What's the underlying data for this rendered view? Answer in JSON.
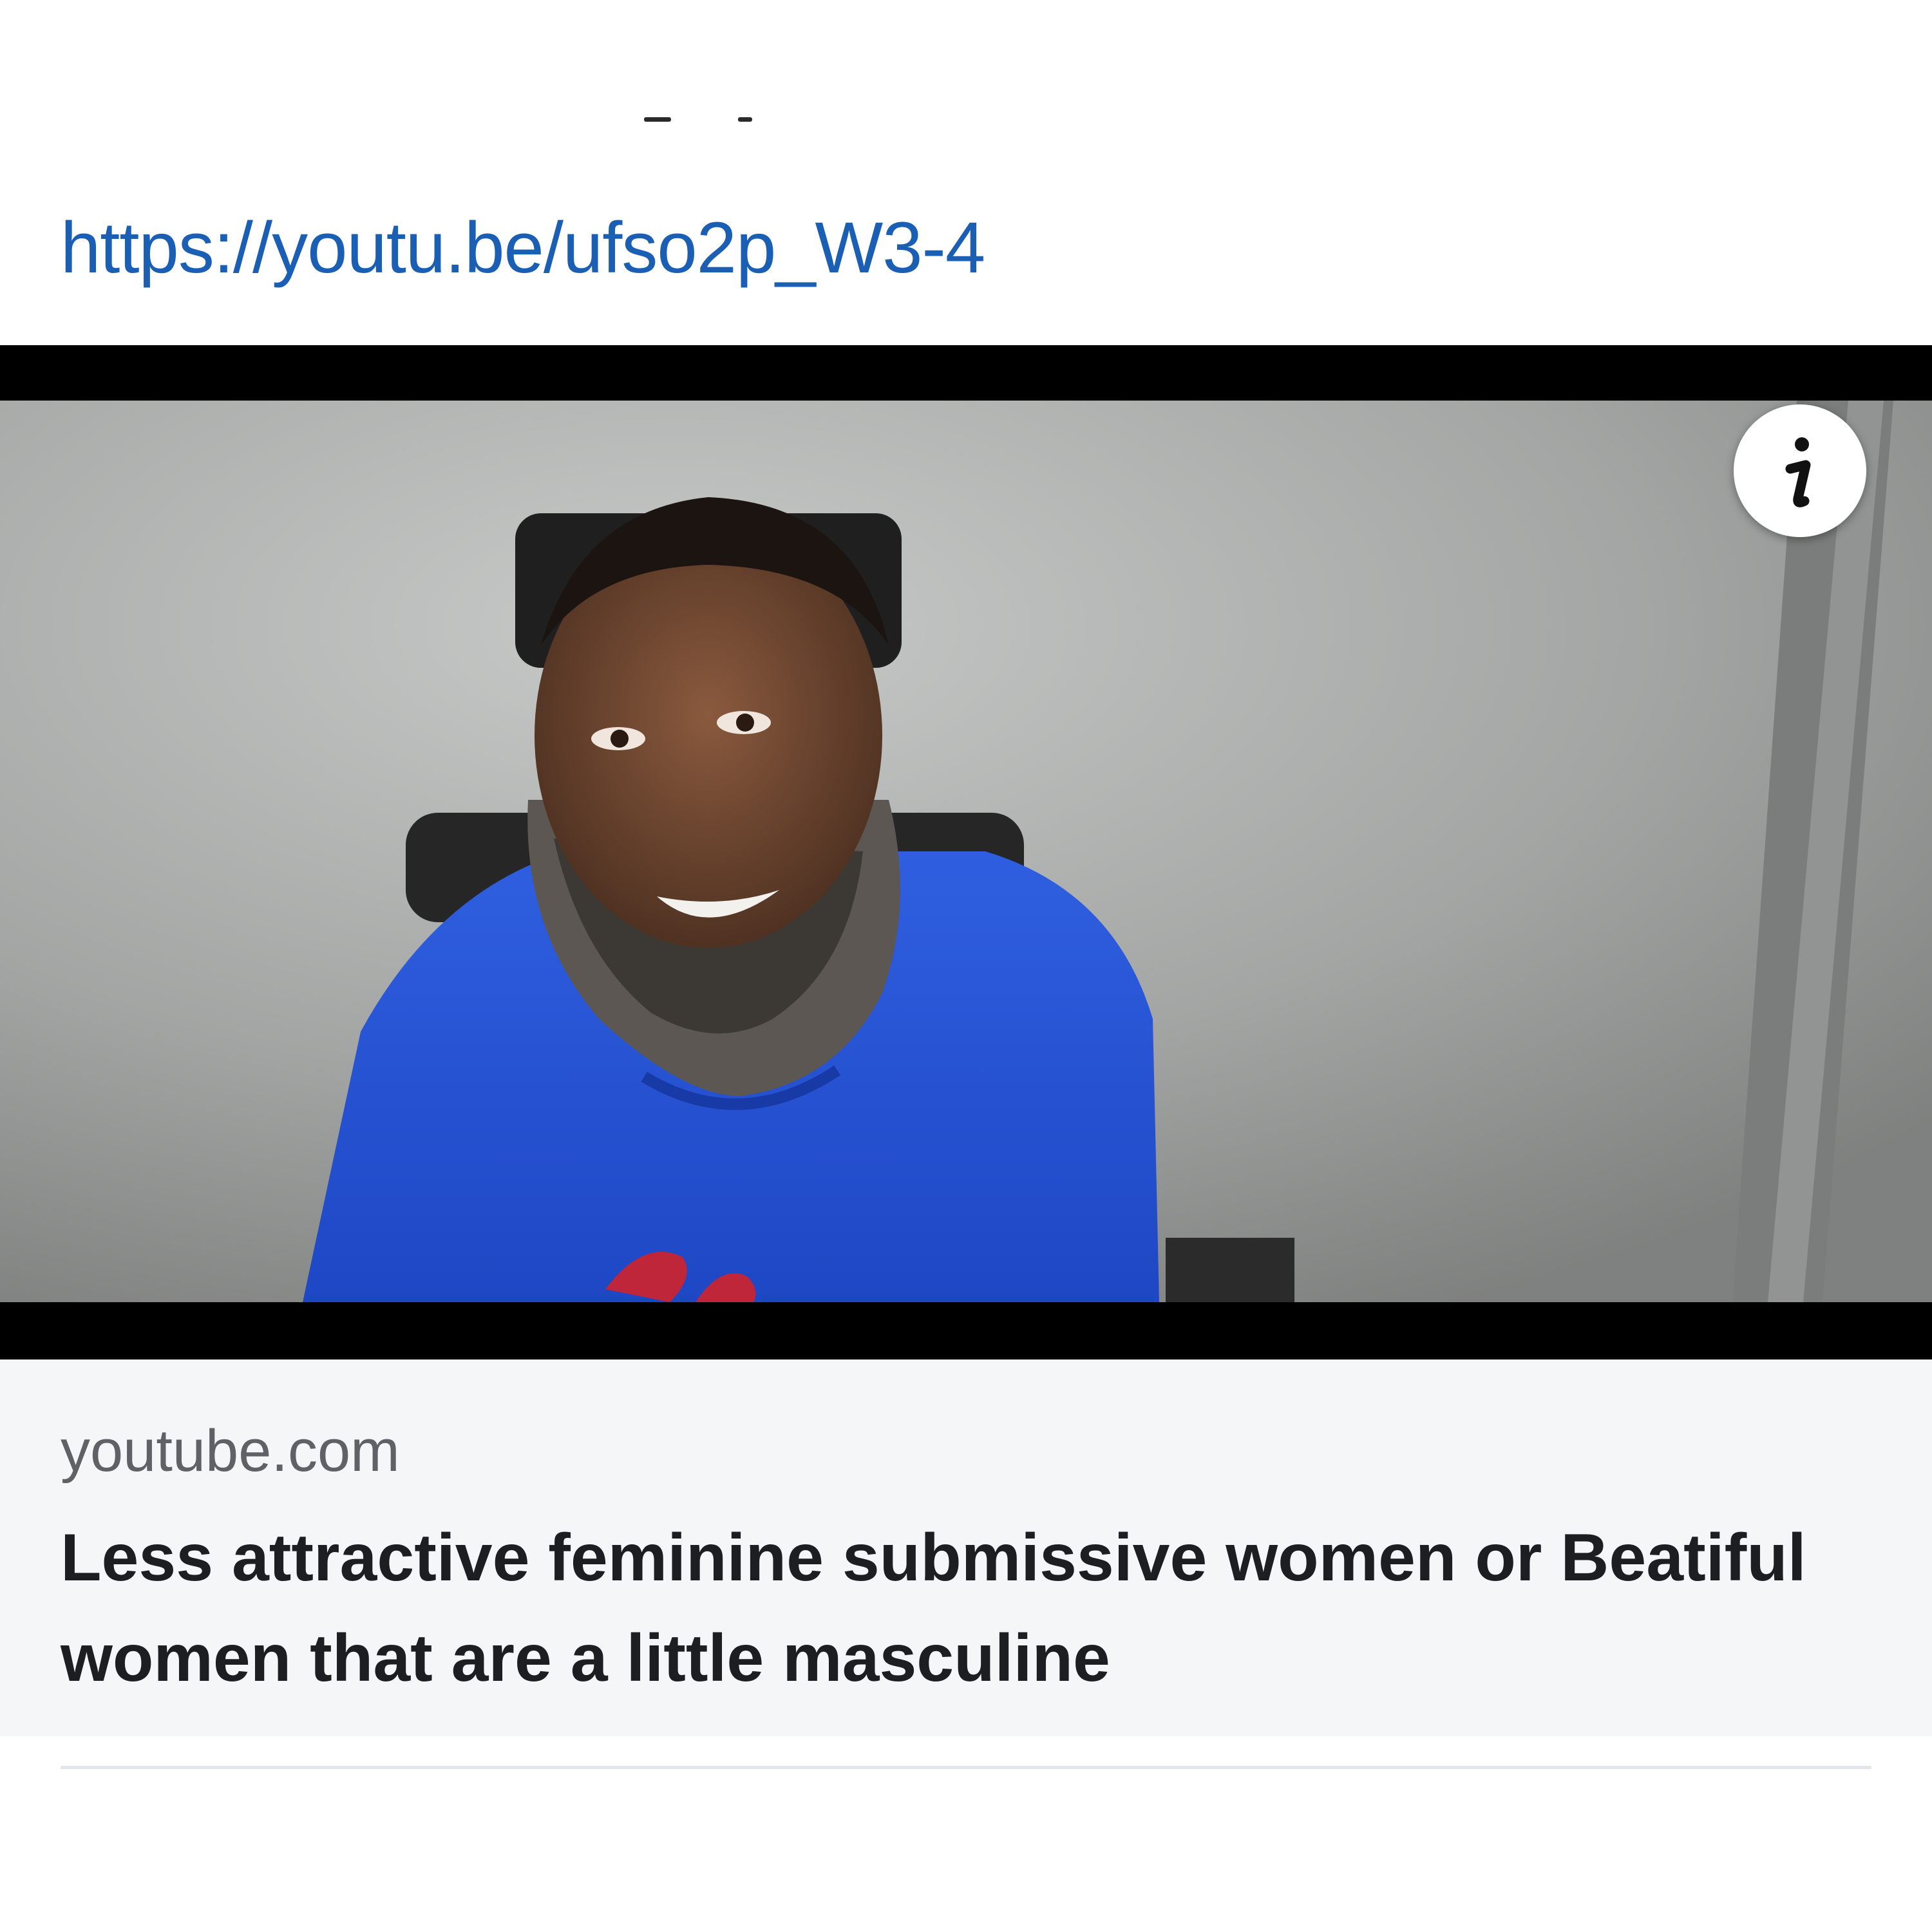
{
  "post": {
    "link_text": "https://youtu.be/ufso2p_W3-4"
  },
  "link_preview": {
    "domain": "youtube.com",
    "title": "Less attractive feminine submissive women or Beatiful women that are a little masculine",
    "thumbnail_icon": "info-icon"
  },
  "colors": {
    "link": "#1a5fb4",
    "preview_background": "#f5f6f8",
    "letterbox": "#000000"
  }
}
